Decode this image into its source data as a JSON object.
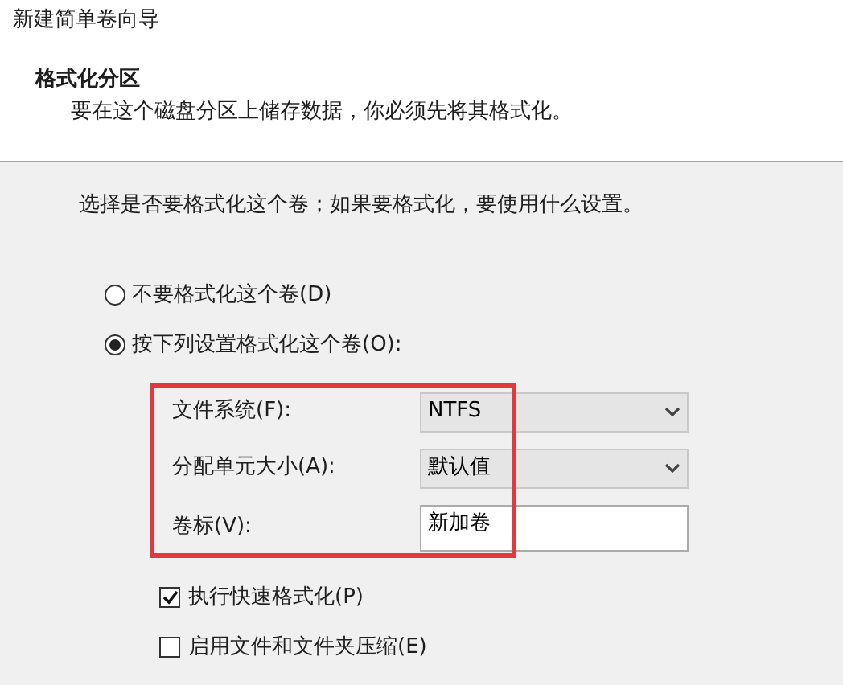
{
  "window": {
    "title": "新建简单卷向导"
  },
  "header": {
    "title": "格式化分区",
    "subtitle": "要在这个磁盘分区上储存数据，你必须先将其格式化。"
  },
  "instruction": "选择是否要格式化这个卷；如果要格式化，要使用什么设置。",
  "options": [
    {
      "label": "不要格式化这个卷(D)",
      "selected": false
    },
    {
      "label": "按下列设置格式化这个卷(O):",
      "selected": true
    }
  ],
  "fields": [
    {
      "label": "文件系统(F):",
      "kind": "select",
      "value": "NTFS"
    },
    {
      "label": "分配单元大小(A):",
      "kind": "select",
      "value": "默认值"
    },
    {
      "label": "卷标(V):",
      "kind": "text",
      "value": "新加卷"
    }
  ],
  "checkboxes": [
    {
      "label": "执行快速格式化(P)",
      "checked": true
    },
    {
      "label": "启用文件和文件夹压缩(E)",
      "checked": false
    }
  ]
}
